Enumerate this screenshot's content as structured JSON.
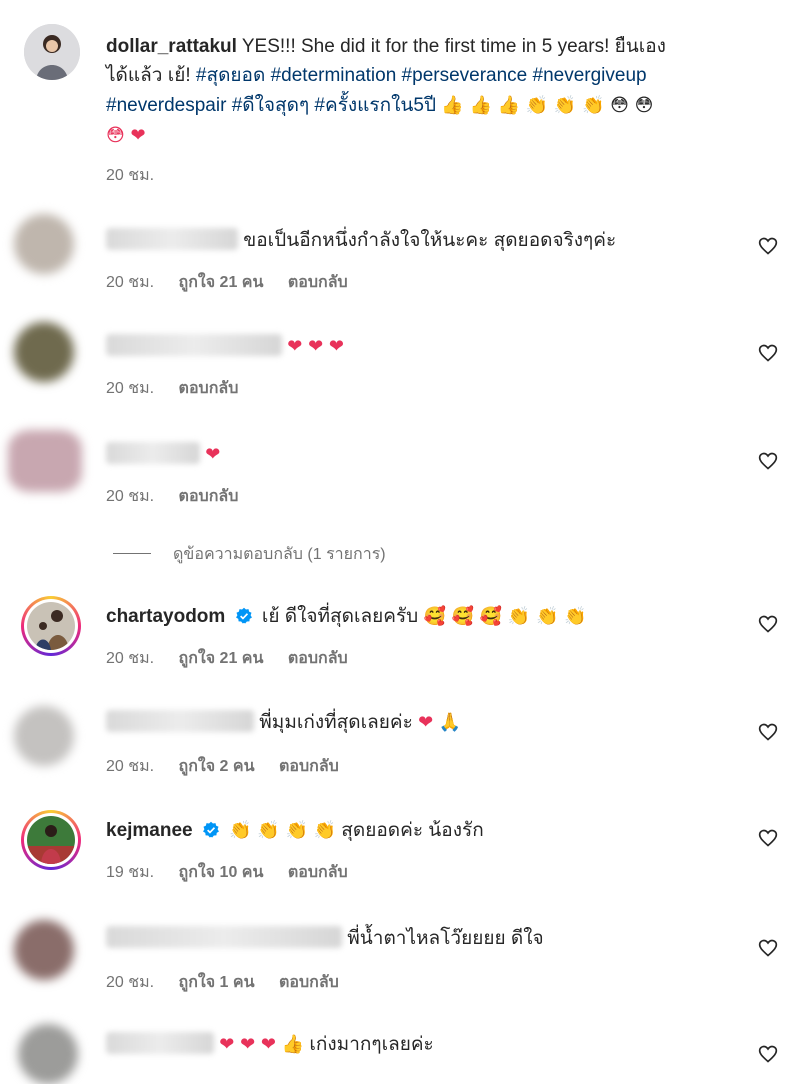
{
  "caption": {
    "username": "dollar_rattakul",
    "text_line1": "YES!!! She did it for the first time in 5 years! ยืนเอง",
    "text_line2_prefix": "ได้แล้ว เย้! ",
    "hashtags_line2": "#สุดยอด #determination #perseverance #nevergiveup",
    "hashtags_line3": "#neverdespair #ดีใจสุดๆ #ครั้งแรกใน5ปี",
    "emojis_line3": "👍 👍 👍 👏 👏 👏 😳 😳",
    "emojis_line4": "😳 ❤",
    "time": "20 ชม."
  },
  "comments": [
    {
      "blurred_user": true,
      "text": "ขอเป็นอีกหนึ่งกำลังใจให้นะคะ สุดยอดจริงๆค่ะ",
      "time": "20 ชม.",
      "likes": "ถูกใจ 21 คน",
      "reply": "ตอบกลับ"
    },
    {
      "blurred_user": true,
      "text": "❤ ❤ ❤",
      "time": "20 ชม.",
      "likes": "",
      "reply": "ตอบกลับ"
    },
    {
      "blurred_user": true,
      "text": "❤",
      "time": "20 ชม.",
      "likes": "",
      "reply": "ตอบกลับ"
    },
    {
      "username": "chartayodom",
      "verified": true,
      "text": "เย้ ดีใจที่สุดเลยครับ",
      "emojis": "🥰 🥰 🥰 👏 👏 👏",
      "time": "20 ชม.",
      "likes": "ถูกใจ 21 คน",
      "reply": "ตอบกลับ"
    },
    {
      "blurred_user": true,
      "text": "พี่มุมเก่งที่สุดเลยค่ะ",
      "emojis": "❤ 🙏",
      "time": "20 ชม.",
      "likes": "ถูกใจ 2 คน",
      "reply": "ตอบกลับ"
    },
    {
      "username": "kejmanee",
      "verified": true,
      "emojis": "👏 👏 👏 👏",
      "text": "สุดยอดค่ะ น้องรัก",
      "time": "19 ชม.",
      "likes": "ถูกใจ 10 คน",
      "reply": "ตอบกลับ"
    },
    {
      "blurred_user": true,
      "text": "พี่น้ำตาไหลโว๊ยยยย ดีใจ",
      "time": "20 ชม.",
      "likes": "ถูกใจ 1 คน",
      "reply": "ตอบกลับ"
    },
    {
      "blurred_user": true,
      "emojis": "❤ ❤ ❤ 👍",
      "text": "เก่งมากๆเลยค่ะ"
    }
  ],
  "view_replies": "ดูข้อความตอบกลับ (1 รายการ)",
  "colors": {
    "heart": "#e8325a",
    "hashtag": "#00376b",
    "meta": "#737373",
    "verified": "#0095f6"
  }
}
